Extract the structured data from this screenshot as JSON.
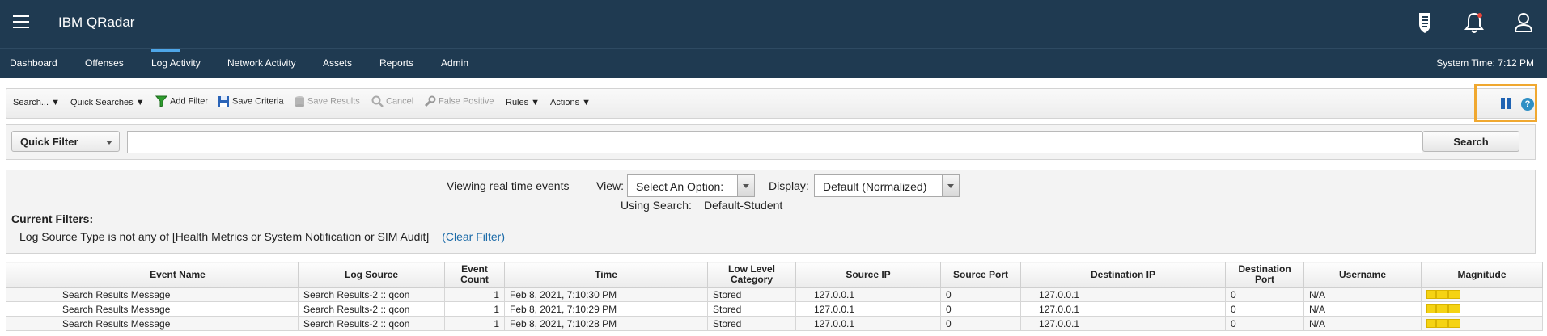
{
  "app": {
    "title": "IBM QRadar",
    "system_time": "System Time: 7:12 PM"
  },
  "nav": {
    "items": [
      {
        "label": "Dashboard"
      },
      {
        "label": "Offenses"
      },
      {
        "label": "Log Activity"
      },
      {
        "label": "Network Activity"
      },
      {
        "label": "Assets"
      },
      {
        "label": "Reports"
      },
      {
        "label": "Admin"
      }
    ],
    "active": "Log Activity"
  },
  "toolbar": {
    "search": "Search...",
    "quick_searches": "Quick Searches",
    "add_filter": "Add Filter",
    "save_criteria": "Save Criteria",
    "save_results": "Save Results",
    "cancel": "Cancel",
    "false_positive": "False Positive",
    "rules": "Rules",
    "actions": "Actions",
    "help": "?"
  },
  "quick_filter": {
    "select_value": "Quick Filter",
    "input_value": "",
    "search_button": "Search"
  },
  "info": {
    "viewing": "Viewing real time events",
    "view_label": "View:",
    "view_value": "Select An Option:",
    "display_label": "Display:",
    "display_value": "Default (Normalized)",
    "using_search_label": "Using Search:",
    "using_search_value": "Default-Student",
    "current_filters_label": "Current Filters:",
    "filter_text": "Log Source Type is not any of [Health Metrics or System Notification or SIM Audit]",
    "clear_filter": "(Clear Filter)"
  },
  "table": {
    "headers": {
      "event_name": "Event Name",
      "log_source": "Log Source",
      "event_count_1": "Event",
      "event_count_2": "Count",
      "time": "Time",
      "llc_1": "Low Level",
      "llc_2": "Category",
      "source_ip": "Source IP",
      "source_port": "Source Port",
      "destination_ip": "Destination IP",
      "dest_port_1": "Destination",
      "dest_port_2": "Port",
      "username": "Username",
      "magnitude": "Magnitude"
    },
    "rows": [
      {
        "event_name": "Search Results Message",
        "log_source": "Search Results-2 :: qcon",
        "event_count": "1",
        "time": "Feb 8, 2021, 7:10:30 PM",
        "category": "Stored",
        "source_ip": "127.0.0.1",
        "source_port": "0",
        "destination_ip": "127.0.0.1",
        "destination_port": "0",
        "username": "N/A"
      },
      {
        "event_name": "Search Results Message",
        "log_source": "Search Results-2 :: qcon",
        "event_count": "1",
        "time": "Feb 8, 2021, 7:10:29 PM",
        "category": "Stored",
        "source_ip": "127.0.0.1",
        "source_port": "0",
        "destination_ip": "127.0.0.1",
        "destination_port": "0",
        "username": "N/A"
      },
      {
        "event_name": "Search Results Message",
        "log_source": "Search Results-2 :: qcon",
        "event_count": "1",
        "time": "Feb 8, 2021, 7:10:28 PM",
        "category": "Stored",
        "source_ip": "127.0.0.1",
        "source_port": "0",
        "destination_ip": "127.0.0.1",
        "destination_port": "0",
        "username": "N/A"
      }
    ]
  },
  "colors": {
    "header_bg": "#1f3a51",
    "active_tab": "#4ea6e8",
    "highlight": "#f0a830",
    "magnitude": "#f5d313",
    "link": "#1a6aa8"
  },
  "icons": [
    "menu-icon",
    "shield-icon",
    "bell-icon",
    "user-icon",
    "filter-icon",
    "save-icon",
    "database-icon",
    "cancel-icon",
    "wrench-icon",
    "pause-icon",
    "help-icon"
  ]
}
